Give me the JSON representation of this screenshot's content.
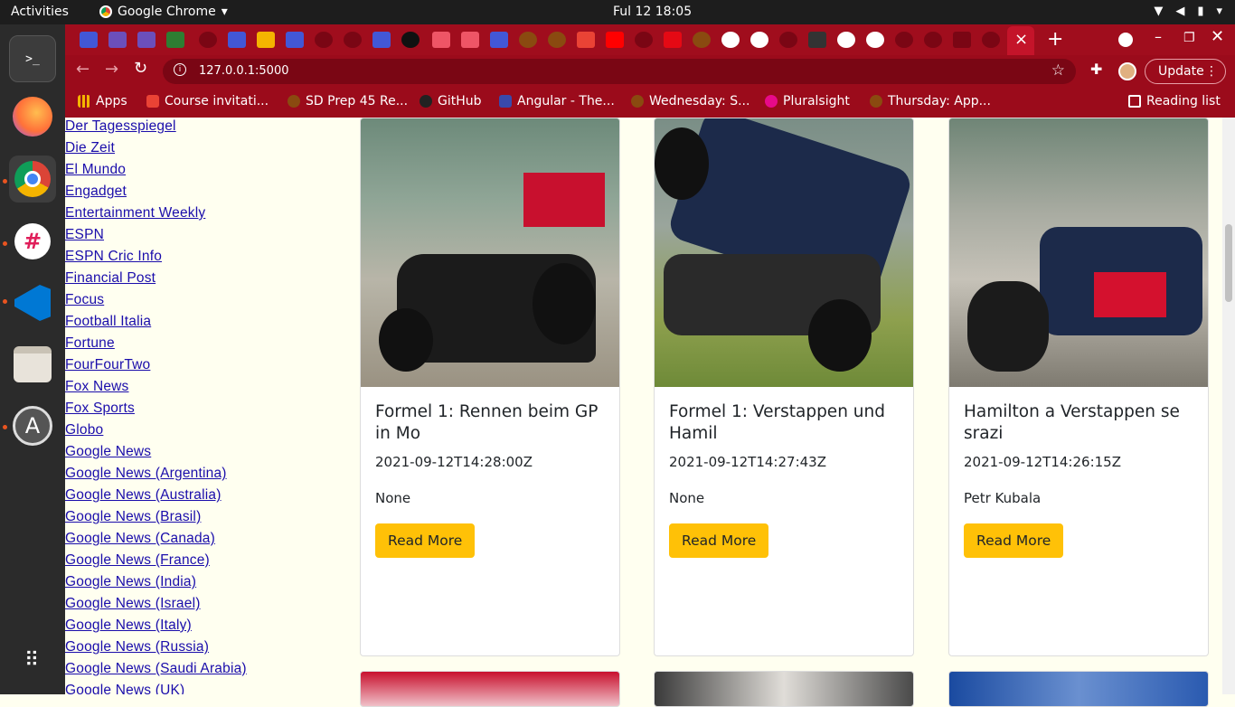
{
  "topbar": {
    "activities": "Activities",
    "app_name": "Google Chrome",
    "clock": "Ful 12  18:05"
  },
  "browser": {
    "url": "127.0.0.1:5000",
    "update_label": "Update",
    "bookmarks": [
      {
        "label": "Apps",
        "icon": "apps-grid-icon"
      },
      {
        "label": "Course invitati...",
        "icon": "gmail-icon"
      },
      {
        "label": "SD Prep 45 Re...",
        "icon": "palm-icon"
      },
      {
        "label": "GitHub",
        "icon": "github-icon"
      },
      {
        "label": "Angular - The...",
        "icon": "angular-icon"
      },
      {
        "label": "Wednesday: S...",
        "icon": "palm-icon"
      },
      {
        "label": "Pluralsight",
        "icon": "pluralsight-icon"
      },
      {
        "label": "Thursday: App...",
        "icon": "palm-icon"
      }
    ],
    "reading_list": "Reading list"
  },
  "sidebar": {
    "links": [
      "Der Tagesspiegel",
      "Die Zeit",
      "El Mundo",
      "Engadget",
      "Entertainment Weekly",
      "ESPN",
      "ESPN Cric Info",
      "Financial Post",
      "Focus",
      "Football Italia",
      "Fortune",
      "FourFourTwo",
      "Fox News",
      "Fox Sports",
      "Globo",
      "Google News",
      "Google News (Argentina)",
      "Google News (Australia)",
      "Google News (Brasil)",
      "Google News (Canada)",
      "Google News (France)",
      "Google News (India)",
      "Google News (Israel)",
      "Google News (Italy)",
      "Google News (Russia)",
      "Google News (Saudi Arabia)",
      "Google News (UK)"
    ]
  },
  "cards": [
    {
      "title": "Formel 1: Rennen beim GP in Mo",
      "date": "2021-09-12T14:28:00Z",
      "author": "None",
      "button": "Read More"
    },
    {
      "title": "Formel 1: Verstappen und Hamil",
      "date": "2021-09-12T14:27:43Z",
      "author": "None",
      "button": "Read More"
    },
    {
      "title": "Hamilton a Verstappen se srazi",
      "date": "2021-09-12T14:26:15Z",
      "author": "Petr Kubala",
      "button": "Read More"
    }
  ],
  "colors": {
    "chrome": "#a00d1d",
    "button": "#ffc107",
    "link": "#1a0dab"
  }
}
